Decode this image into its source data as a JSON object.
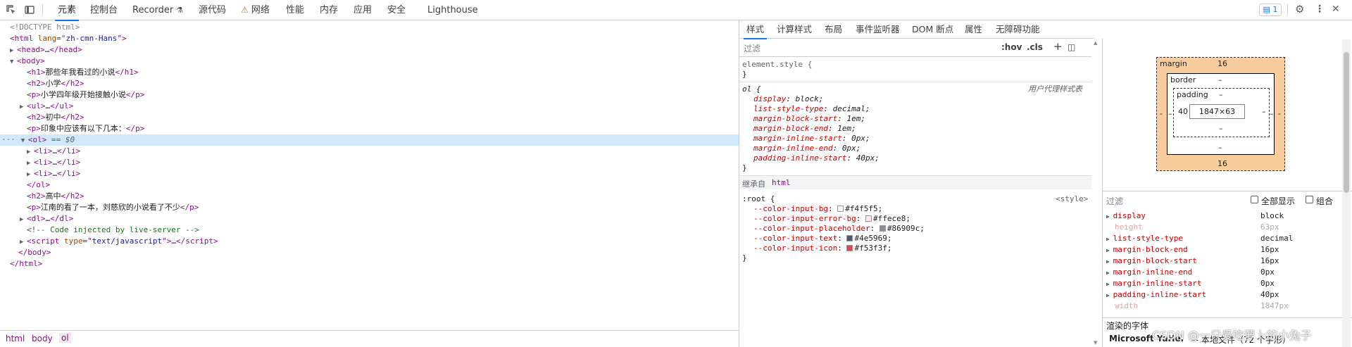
{
  "toolbar": {
    "tabs": [
      "元素",
      "控制台",
      "Recorder",
      "源代码",
      "网络",
      "性能",
      "内存",
      "应用",
      "安全",
      "Lighthouse"
    ],
    "issues_count": "1",
    "icons": [
      "inspect-icon",
      "device-icon",
      "flask-icon",
      "warning-icon",
      "issues-icon",
      "gear-icon",
      "more-icon",
      "close-icon"
    ]
  },
  "dom": {
    "lines": [
      {
        "t": "<!DOCTYPE html>",
        "indent": 0,
        "kind": "doctype"
      },
      {
        "t": "html",
        "attr": "lang",
        "val": "zh-cmn-Hans",
        "indent": 0,
        "kind": "open"
      },
      {
        "t": "head",
        "indent": 1,
        "kind": "collapsed",
        "arrow": "▶"
      },
      {
        "t": "body",
        "indent": 1,
        "kind": "open-arrow",
        "arrow": "▼"
      },
      {
        "t": "h1",
        "text": "那些年我看过的小说",
        "indent": 2,
        "kind": "inline"
      },
      {
        "t": "h2",
        "text": "小学",
        "indent": 2,
        "kind": "inline"
      },
      {
        "t": "p",
        "text": "小学四年级开始接触小说",
        "indent": 2,
        "kind": "inline"
      },
      {
        "t": "ul",
        "indent": 2,
        "kind": "collapsed",
        "arrow": "▶"
      },
      {
        "t": "h2",
        "text": "初中",
        "indent": 2,
        "kind": "inline"
      },
      {
        "t": "p",
        "text": "印象中应该有以下几本：",
        "indent": 2,
        "kind": "inline"
      },
      {
        "t": "ol",
        "indent": 2,
        "kind": "selected",
        "arrow": "▼",
        "marker": "== $0"
      },
      {
        "t": "li",
        "indent": 3,
        "kind": "collapsed",
        "arrow": "▶"
      },
      {
        "t": "li",
        "indent": 3,
        "kind": "collapsed",
        "arrow": "▶"
      },
      {
        "t": "li",
        "indent": 3,
        "kind": "collapsed",
        "arrow": "▶"
      },
      {
        "t": "ol",
        "indent": 2,
        "kind": "close"
      },
      {
        "t": "h2",
        "text": "高中",
        "indent": 2,
        "kind": "inline"
      },
      {
        "t": "p",
        "text": "江南的看了一本，刘慈欣的小说看了不少",
        "indent": 2,
        "kind": "inline"
      },
      {
        "t": "dl",
        "indent": 2,
        "kind": "collapsed",
        "arrow": "▶"
      },
      {
        "t": "<!-- Code injected by live-server -->",
        "indent": 2,
        "kind": "comment"
      },
      {
        "t": "script",
        "attr": "type",
        "val": "text/javascript",
        "indent": 2,
        "kind": "collapsed",
        "arrow": "▶"
      },
      {
        "t": "body",
        "indent": 1,
        "kind": "close"
      },
      {
        "t": "html",
        "indent": 0,
        "kind": "close"
      }
    ],
    "ellipsis": "…",
    "dots": "···"
  },
  "breadcrumbs": [
    "html",
    "body",
    "ol"
  ],
  "styles_tabs": [
    "样式",
    "计算样式",
    "布局",
    "事件监听器",
    "DOM 断点",
    "属性",
    "无障碍功能"
  ],
  "styles": {
    "filter_placeholder": "过滤",
    "hov": ":hov",
    "cls": ".cls",
    "plus": "+",
    "element_style": "element.style {",
    "close_brace": "}",
    "ol_selector": "ol {",
    "ua_label": "用户代理样式表",
    "ol_props": [
      [
        "display",
        "block"
      ],
      [
        "list-style-type",
        "decimal"
      ],
      [
        "margin-block-start",
        "1em"
      ],
      [
        "margin-block-end",
        "1em"
      ],
      [
        "margin-inline-start",
        "0px"
      ],
      [
        "margin-inline-end",
        "0px"
      ],
      [
        "padding-inline-start",
        "40px"
      ]
    ],
    "inherited_label": "继承自",
    "inherited_from": "html",
    "root_selector": ":root {",
    "root_source": "<style>",
    "root_props": [
      [
        "--color-input-bg",
        "#f4f5f5",
        "#f4f5f5"
      ],
      [
        "--color-input-error-bg",
        "#ffece8",
        "#ffece8"
      ],
      [
        "--color-input-placeholder",
        "#86909c",
        "#86909c"
      ],
      [
        "--color-input-text",
        "#4e5969",
        "#4e5969"
      ],
      [
        "--color-input-icon",
        "#f53f3f",
        "#f53f3f"
      ]
    ]
  },
  "boxmodel": {
    "margin_label": "margin",
    "margin_top": "16",
    "margin_bottom": "16",
    "margin_left": "-",
    "margin_right": "-",
    "border_label": "border",
    "border_top": "–",
    "border_bottom": "–",
    "border_left": "–",
    "border_right": "–",
    "padding_label": "padding",
    "padding_top": "–",
    "padding_bottom": "–",
    "padding_left": "40",
    "padding_right": "–",
    "content": "1847×63"
  },
  "computed": {
    "filter_placeholder": "过滤",
    "show_all": "全部显示",
    "group": "组合",
    "props": [
      [
        "display",
        "block",
        false,
        true
      ],
      [
        "height",
        "63px",
        true,
        false
      ],
      [
        "list-style-type",
        "decimal",
        false,
        true
      ],
      [
        "margin-block-end",
        "16px",
        false,
        true
      ],
      [
        "margin-block-start",
        "16px",
        false,
        true
      ],
      [
        "margin-inline-end",
        "0px",
        false,
        true
      ],
      [
        "margin-inline-start",
        "0px",
        false,
        true
      ],
      [
        "padding-inline-start",
        "40px",
        false,
        true
      ],
      [
        "width",
        "1847px",
        true,
        false
      ]
    ],
    "rendered_fonts_label": "渲染的字体",
    "font_name": "Microsoft YaHei",
    "font_source": "— 本地文件（72 个字形）"
  },
  "watermark": "CSDN @一只爱吃萝卜的小兔子"
}
